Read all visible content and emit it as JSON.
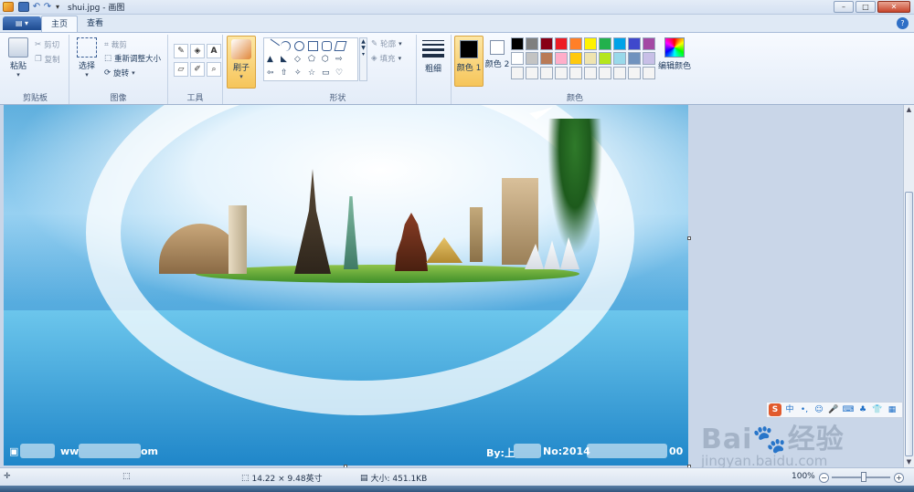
{
  "window": {
    "title": "shui.jpg - 画图",
    "buttons": {
      "minimize": "–",
      "maximize": "□",
      "close": "✕"
    }
  },
  "quick_access": {
    "more": "▾"
  },
  "tabs": [
    {
      "label": "主页",
      "active": true
    },
    {
      "label": "查看",
      "active": false
    }
  ],
  "menu_button": "▤ ▾",
  "help": "?",
  "ribbon": {
    "clipboard": {
      "label": "剪贴板",
      "paste": "粘贴",
      "cut": "剪切",
      "copy": "复制"
    },
    "image": {
      "label": "图像",
      "select": "选择",
      "crop": "裁剪",
      "resize": "重新调整大小",
      "rotate": "旋转"
    },
    "tools": {
      "label": "工具"
    },
    "brushes": {
      "label": "刷子"
    },
    "shapes": {
      "label": "形状",
      "outline": "轮廓",
      "fill": "填充"
    },
    "size": {
      "label": "粗细"
    },
    "colors": {
      "label": "颜色",
      "color1": "颜色 1",
      "color2": "颜色 2",
      "edit": "编辑颜色",
      "color1_value": "#000000",
      "color2_value": "#ffffff",
      "palette": [
        "#000000",
        "#7f7f7f",
        "#880015",
        "#ed1c24",
        "#ff7f27",
        "#fff200",
        "#22b14c",
        "#00a2e8",
        "#3f48cc",
        "#a349a4",
        "#ffffff",
        "#c3c3c3",
        "#b97a57",
        "#ffaec9",
        "#ffc90e",
        "#efe4b0",
        "#b5e61d",
        "#99d9ea",
        "#7092be",
        "#c8bfe7",
        "#f4f4f4",
        "#f4f4f4",
        "#f4f4f4",
        "#f4f4f4",
        "#f4f4f4",
        "#f4f4f4",
        "#f4f4f4",
        "#f4f4f4",
        "#f4f4f4",
        "#f4f4f4"
      ]
    }
  },
  "canvas": {
    "text_left": "ww",
    "text_left_end": "om",
    "text_right": "By:上",
    "text_right_mid": "No:2014",
    "text_right_end": "00"
  },
  "floating_toolbar": [
    "S",
    "中",
    "•,",
    "☺",
    "🎤",
    "⌨",
    "♣",
    "👕",
    "▦"
  ],
  "watermark": {
    "brand": "Bai",
    "brand2": "经验",
    "url": "jingyan.baidu.com"
  },
  "status": {
    "dimensions": "14.22 × 9.48英寸",
    "size": "大小: 451.1KB",
    "zoom": "100%"
  }
}
